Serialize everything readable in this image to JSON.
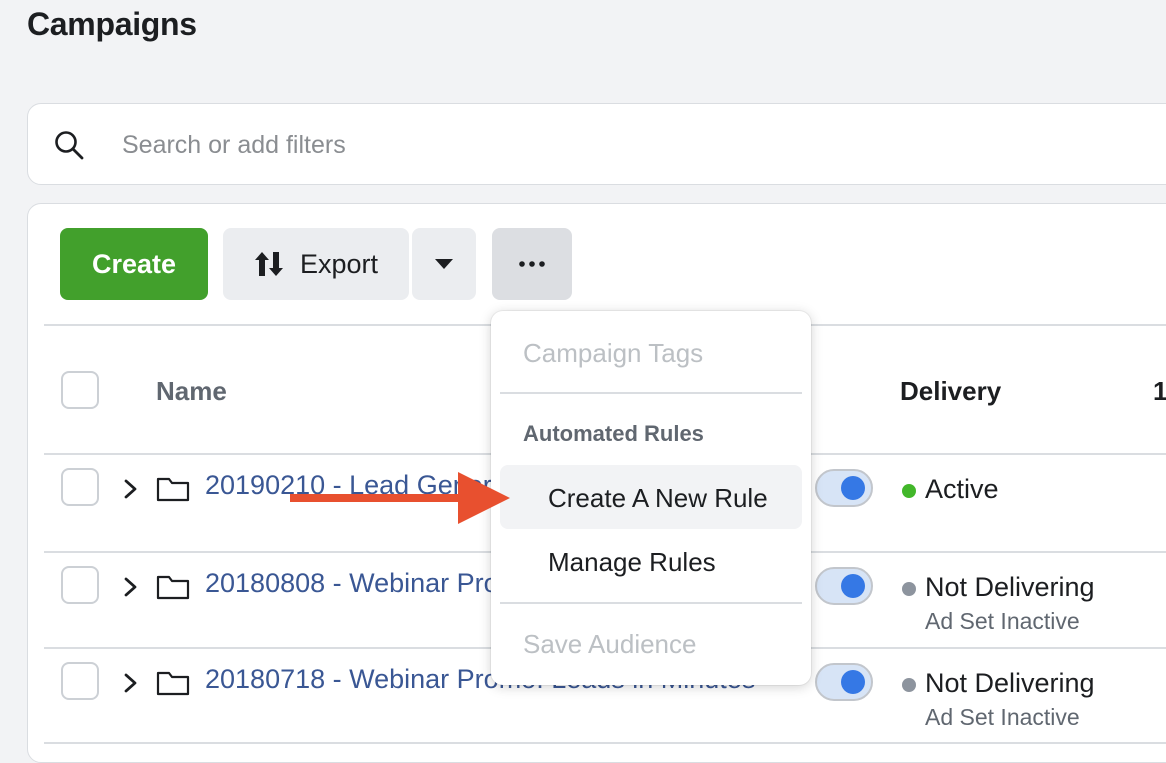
{
  "page": {
    "title": "Campaigns"
  },
  "search": {
    "placeholder": "Search or add filters",
    "icon": "search-icon"
  },
  "toolbar": {
    "create_label": "Create",
    "export_label": "Export",
    "export_icon": "import-export-icon",
    "dropdown_icon": "caret-down-icon",
    "more_icon": "ellipsis-icon",
    "create_color": "#42a02c"
  },
  "table": {
    "columns": {
      "name": "Name",
      "delivery": "Delivery",
      "extra": "1"
    },
    "rows": [
      {
        "name": "20190210 - Lead Gener",
        "on": true,
        "status": "Active",
        "status_color": "#42b72a",
        "substatus": ""
      },
      {
        "name": "20180808 - Webinar Pro",
        "on": true,
        "status": "Not Delivering",
        "status_color": "#8d949e",
        "substatus": "Ad Set Inactive"
      },
      {
        "name": "20180718 - Webinar Promo: Leads in Minutes",
        "on": true,
        "status": "Not Delivering",
        "status_color": "#8d949e",
        "substatus": "Ad Set Inactive"
      }
    ]
  },
  "menu": {
    "campaign_tags": "Campaign Tags",
    "automated_rules_header": "Automated Rules",
    "create_rule": "Create A New Rule",
    "manage_rules": "Manage Rules",
    "save_audience": "Save Audience"
  },
  "annotation": {
    "arrow_color": "#e8502f"
  }
}
